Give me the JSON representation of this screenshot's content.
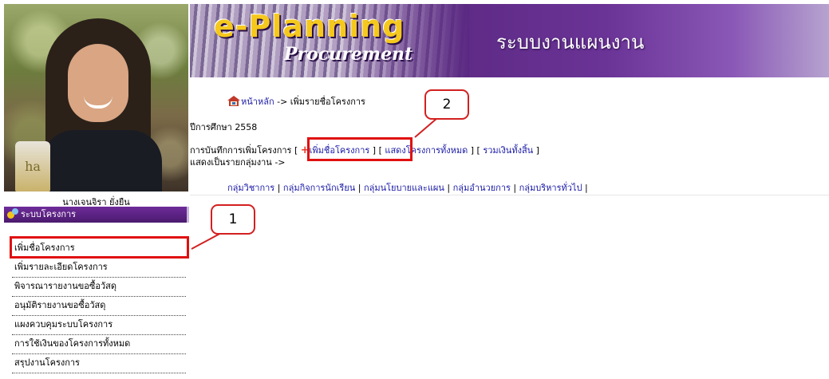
{
  "user": {
    "name": "นางเจนจิรา ยั่งยืน"
  },
  "banner": {
    "logo_main": "e-Planning",
    "logo_sub": "Procurement",
    "title": "ระบบงานแผนงาน"
  },
  "menu": {
    "header": "ระบบโครงการ",
    "items": [
      {
        "label": "เพิ่มชื่อโครงการ"
      },
      {
        "label": "เพิ่มรายละเอียดโครงการ"
      },
      {
        "label": "พิจารณารายงานขอซื้อวัสดุ"
      },
      {
        "label": "อนุมัติรายงานขอซื้อวัสดุ"
      },
      {
        "label": "แผงควบคุมระบบโครงการ"
      },
      {
        "label": "การใช้เงินของโครงการทั้งหมด"
      },
      {
        "label": "สรุปงานโครงการ"
      }
    ]
  },
  "breadcrumb": {
    "home": "หน้าหลัก",
    "separator": " -> ",
    "current": "เพิ่มรายชื่อโครงการ"
  },
  "academic_year": {
    "label": "ปีการศึกษา",
    "value": "2558"
  },
  "actions": {
    "prefix": "การบันทึกการเพิ่มโครงการ",
    "add_project": "เพิ่มชื่อโครงการ",
    "show_all": "แสดงโครงการทั้งหมด",
    "total_money": "รวมเงินทั้งสิ้น"
  },
  "group_view": {
    "label": "แสดงเป็นรายกลุ่มงาน ->"
  },
  "departments": [
    "กลุ่มวิชาการ",
    "กลุ่มกิจการนักเรียน",
    "กลุ่มนโยบายและแผน",
    "กลุ่มอำนวยการ",
    "กลุ่มบริหารทั่วไป"
  ],
  "callouts": [
    {
      "number": "1"
    },
    {
      "number": "2"
    }
  ],
  "colors": {
    "menu_header": "#4b1a6e",
    "link": "#1a1aa6",
    "callout": "#e01010",
    "banner": "#5d2a84"
  }
}
